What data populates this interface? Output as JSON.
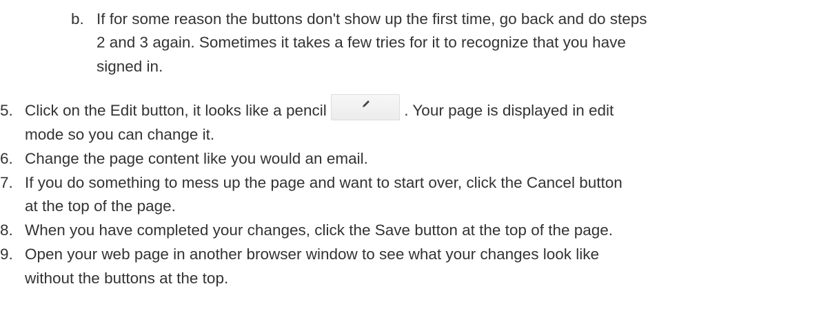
{
  "items": [
    {
      "marker": "b.",
      "lines": [
        "If for some reason the buttons don't show up the first time, go back and do steps",
        "2 and 3 again.  Sometimes it takes a few tries for it to recognize that you have",
        "signed in."
      ]
    },
    {
      "marker": "5.",
      "line1_before": "Click on the Edit button, it looks like a pencil",
      "line1_after": ".  Your page is displayed in edit",
      "line2": "mode so you can change it."
    },
    {
      "marker": "6.",
      "lines": [
        "Change the page content like you would an email."
      ]
    },
    {
      "marker": "7.",
      "lines": [
        "If you do something to mess up the page and want to start over, click the Cancel button",
        "at the top of the page."
      ]
    },
    {
      "marker": "8.",
      "lines": [
        "When you have completed your changes, click the Save button at the top of the page."
      ]
    },
    {
      "marker": "9.",
      "lines": [
        "Open your web page in another browser window to see what your changes look like",
        "without the buttons at the top."
      ]
    }
  ],
  "icons": {
    "edit_button_icon": "pencil-icon"
  }
}
